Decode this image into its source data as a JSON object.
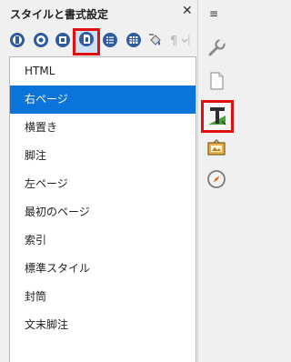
{
  "panel": {
    "title": "スタイルと書式設定",
    "close_label": "✕"
  },
  "toolbar": {
    "buttons": [
      {
        "icon": "paragraph-styles-icon"
      },
      {
        "icon": "character-styles-icon"
      },
      {
        "icon": "frame-styles-icon"
      },
      {
        "icon": "page-styles-icon",
        "selected": true
      },
      {
        "icon": "list-styles-icon"
      },
      {
        "icon": "table-styles-icon"
      },
      {
        "icon": "fill-format-icon"
      },
      {
        "icon": "new-style-icon"
      }
    ]
  },
  "style_list": {
    "items": [
      {
        "label": "HTML"
      },
      {
        "label": "右ページ",
        "selected": true
      },
      {
        "label": "横置き"
      },
      {
        "label": "脚注"
      },
      {
        "label": "左ページ"
      },
      {
        "label": "最初のページ"
      },
      {
        "label": "索引"
      },
      {
        "label": "標準スタイル"
      },
      {
        "label": "封筒"
      },
      {
        "label": "文末脚注"
      }
    ]
  },
  "sidebar": {
    "menu_glyph": "≡",
    "buttons": [
      {
        "icon": "properties-icon"
      },
      {
        "icon": "page-icon"
      },
      {
        "icon": "styles-icon",
        "active": true
      },
      {
        "icon": "gallery-icon"
      },
      {
        "icon": "navigator-icon"
      }
    ]
  },
  "colors": {
    "selection": "#0a74da",
    "highlight_border": "#e01010"
  }
}
